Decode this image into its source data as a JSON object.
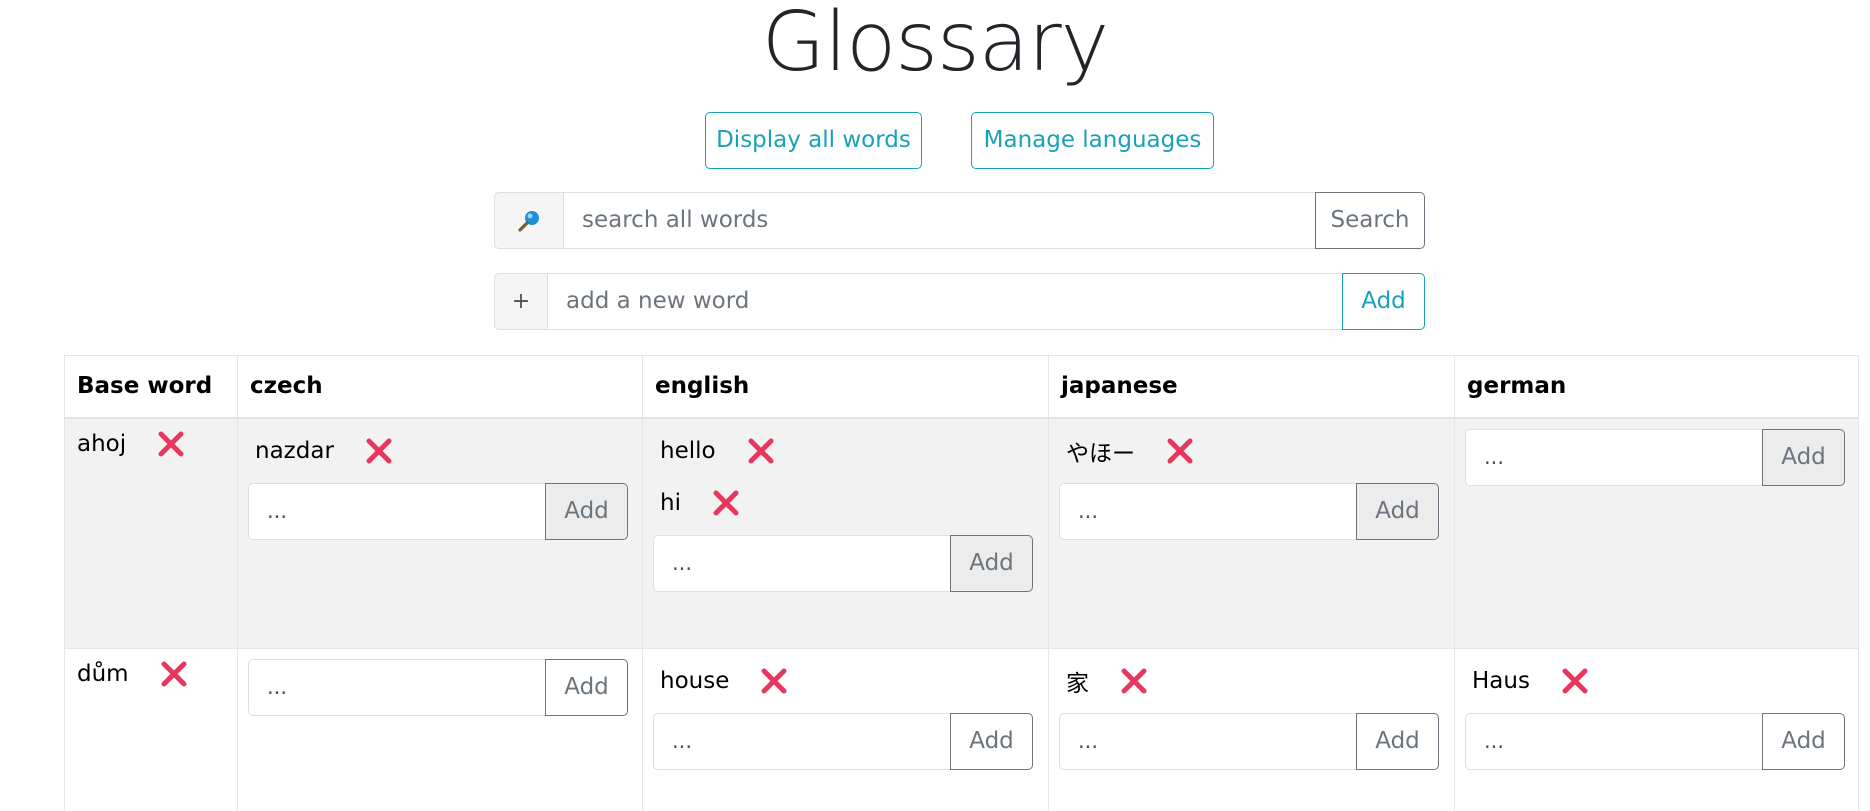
{
  "header": {
    "title": "Glossary",
    "display_all_label": "Display all words",
    "manage_languages_label": "Manage languages"
  },
  "search": {
    "icon": "magnifier-icon",
    "placeholder": "search all words",
    "button_label": "Search"
  },
  "add_word": {
    "prefix": "+",
    "placeholder": "add a new word",
    "button_label": "Add"
  },
  "table": {
    "headers": [
      "Base word",
      "czech",
      "english",
      "japanese",
      "german"
    ],
    "rows": [
      {
        "base_word": "ahoj",
        "czech": [
          "nazdar"
        ],
        "english": [
          "hello",
          "hi"
        ],
        "japanese": [
          "やほー"
        ],
        "german": []
      },
      {
        "base_word": "dům",
        "czech": [],
        "english": [
          "house"
        ],
        "japanese": [
          "家"
        ],
        "german": [
          "Haus"
        ]
      }
    ],
    "cell_input_placeholder": "...",
    "cell_add_label": "Add"
  },
  "colors": {
    "accent": "#17a2b8",
    "delete": "#e8375f",
    "secondary": "#6c757d"
  }
}
